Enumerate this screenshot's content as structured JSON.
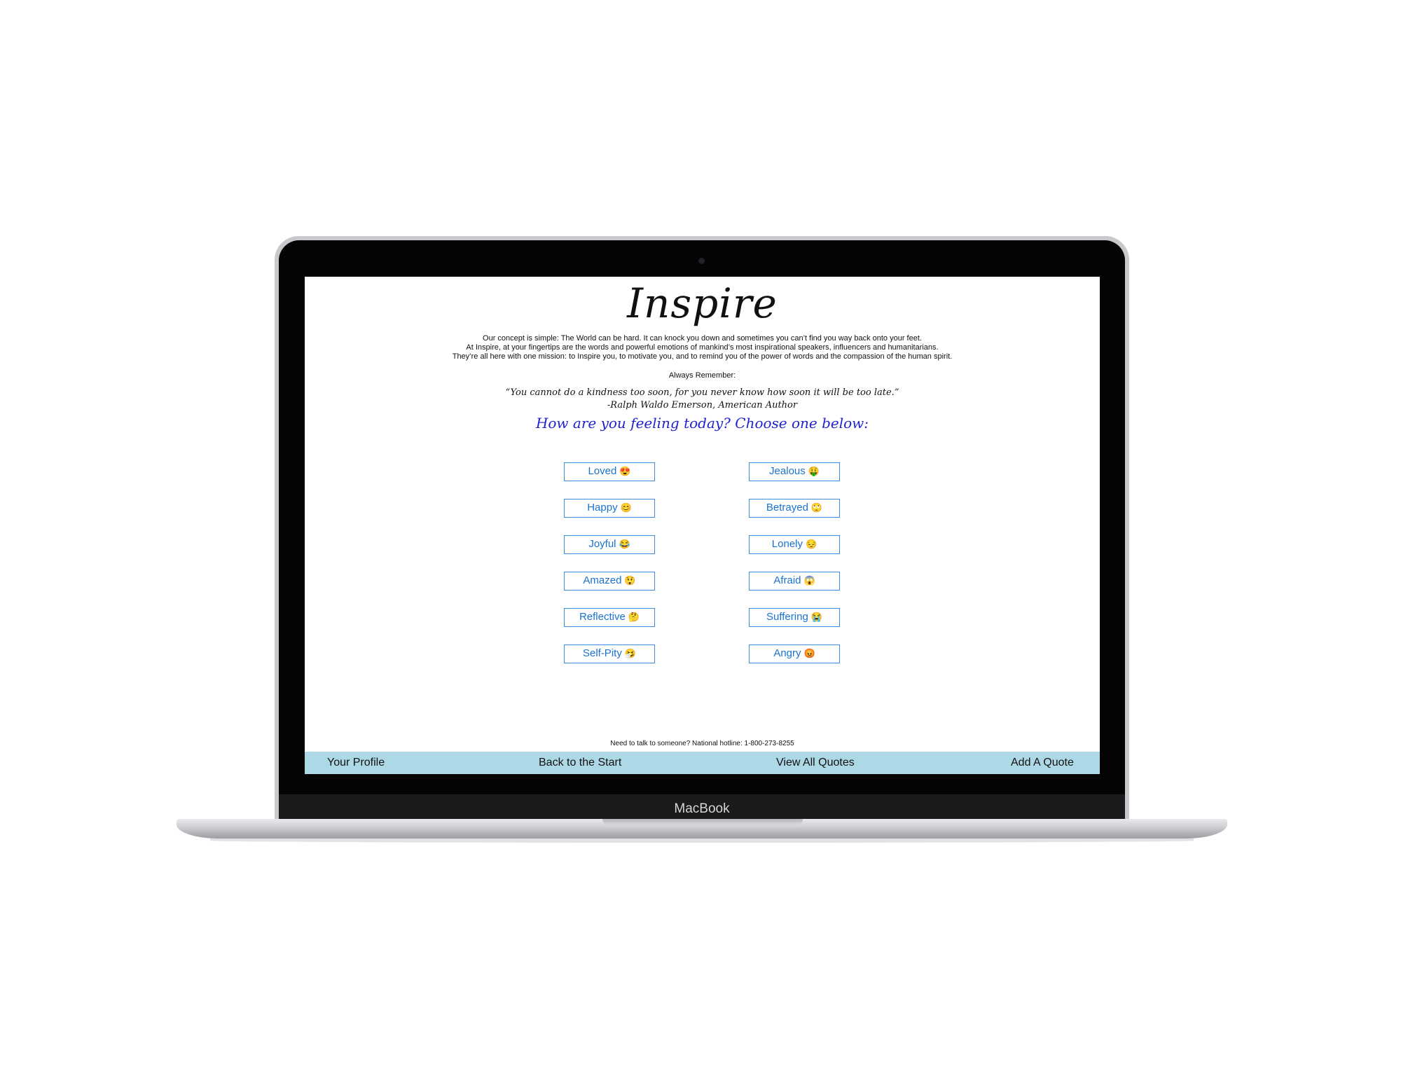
{
  "device": {
    "brand_label": "MacBook"
  },
  "header": {
    "logo": "Inspire",
    "intro_lines": [
      "Our concept is simple: The World can be hard. It can knock you down and sometimes you can’t find you way back onto your feet.",
      "At Inspire, at your fingertips are the words and powerful emotions of mankind’s most inspirational speakers, influencers and humanitarians.",
      "They’re all here with one mission: to Inspire you, to motivate you, and to remind you of the power of words and the compassion of the human spirit."
    ],
    "remember_label": "Always Remember:",
    "quote": "“You cannot do a kindness too soon, for you never know how soon it will be too late.”",
    "quote_author": "-Ralph Waldo Emerson, American Author",
    "prompt": "How are you feeling today? Choose one below:"
  },
  "moods": {
    "left": [
      {
        "label": "Loved",
        "emoji": "😍"
      },
      {
        "label": "Happy",
        "emoji": "😊"
      },
      {
        "label": "Joyful",
        "emoji": "😂"
      },
      {
        "label": "Amazed",
        "emoji": "😲"
      },
      {
        "label": "Reflective",
        "emoji": "🤔"
      },
      {
        "label": "Self-Pity",
        "emoji": "🤧"
      }
    ],
    "right": [
      {
        "label": "Jealous",
        "emoji": "🤑"
      },
      {
        "label": "Betrayed",
        "emoji": "🙄"
      },
      {
        "label": "Lonely",
        "emoji": "😔"
      },
      {
        "label": "Afraid",
        "emoji": "😱"
      },
      {
        "label": "Suffering",
        "emoji": "😭"
      },
      {
        "label": "Angry",
        "emoji": "😡"
      }
    ]
  },
  "footer": {
    "hotline": "Need to talk to someone? National hotline: 1-800-273-8255",
    "nav": {
      "profile": "Your Profile",
      "start": "Back to the Start",
      "all_quotes": "View All Quotes",
      "add_quote": "Add A Quote"
    }
  },
  "colors": {
    "prompt": "#1e22d6",
    "button_border": "#3a8ee0",
    "button_text": "#1a73d0",
    "navbar": "#add8e6"
  }
}
